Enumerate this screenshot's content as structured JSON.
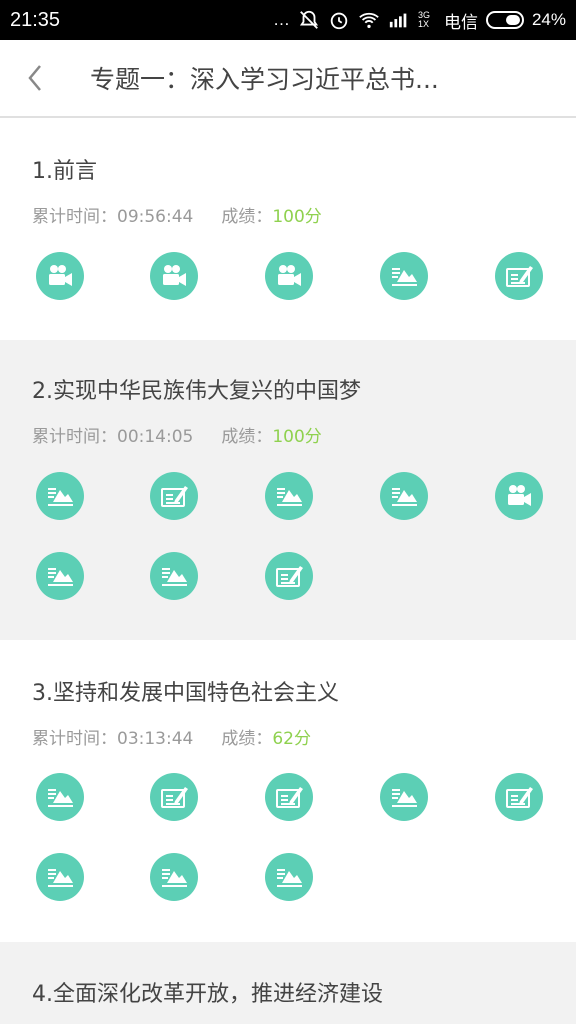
{
  "status": {
    "time": "21:35",
    "net": "3G 1X",
    "carrier": "电信",
    "battery": "24%"
  },
  "header": {
    "title": "专题一：深入学习习近平总书..."
  },
  "sections": [
    {
      "title": "1.前言",
      "time_label": "累计时间：",
      "time": "09:56:44",
      "score_label": "成绩：",
      "score": "100分",
      "items": [
        "video-icon",
        "video-icon",
        "video-icon",
        "article-icon",
        "exam-icon"
      ]
    },
    {
      "title": "2.实现中华民族伟大复兴的中国梦",
      "time_label": "累计时间：",
      "time": "00:14:05",
      "score_label": "成绩：",
      "score": "100分",
      "items": [
        "article-icon",
        "exam-icon",
        "article-icon",
        "article-icon",
        "video-icon",
        "article-icon",
        "article-icon",
        "exam-icon"
      ]
    },
    {
      "title": "3.坚持和发展中国特色社会主义",
      "time_label": "累计时间：",
      "time": "03:13:44",
      "score_label": "成绩：",
      "score": "62分",
      "items": [
        "article-icon",
        "exam-icon",
        "exam-icon",
        "article-icon",
        "exam-icon",
        "article-icon",
        "article-icon",
        "article-icon"
      ]
    },
    {
      "title": "4.全面深化改革开放，推进经济建设"
    }
  ],
  "colors": {
    "accent": "#5ccfb5",
    "score": "#8fd14f"
  }
}
